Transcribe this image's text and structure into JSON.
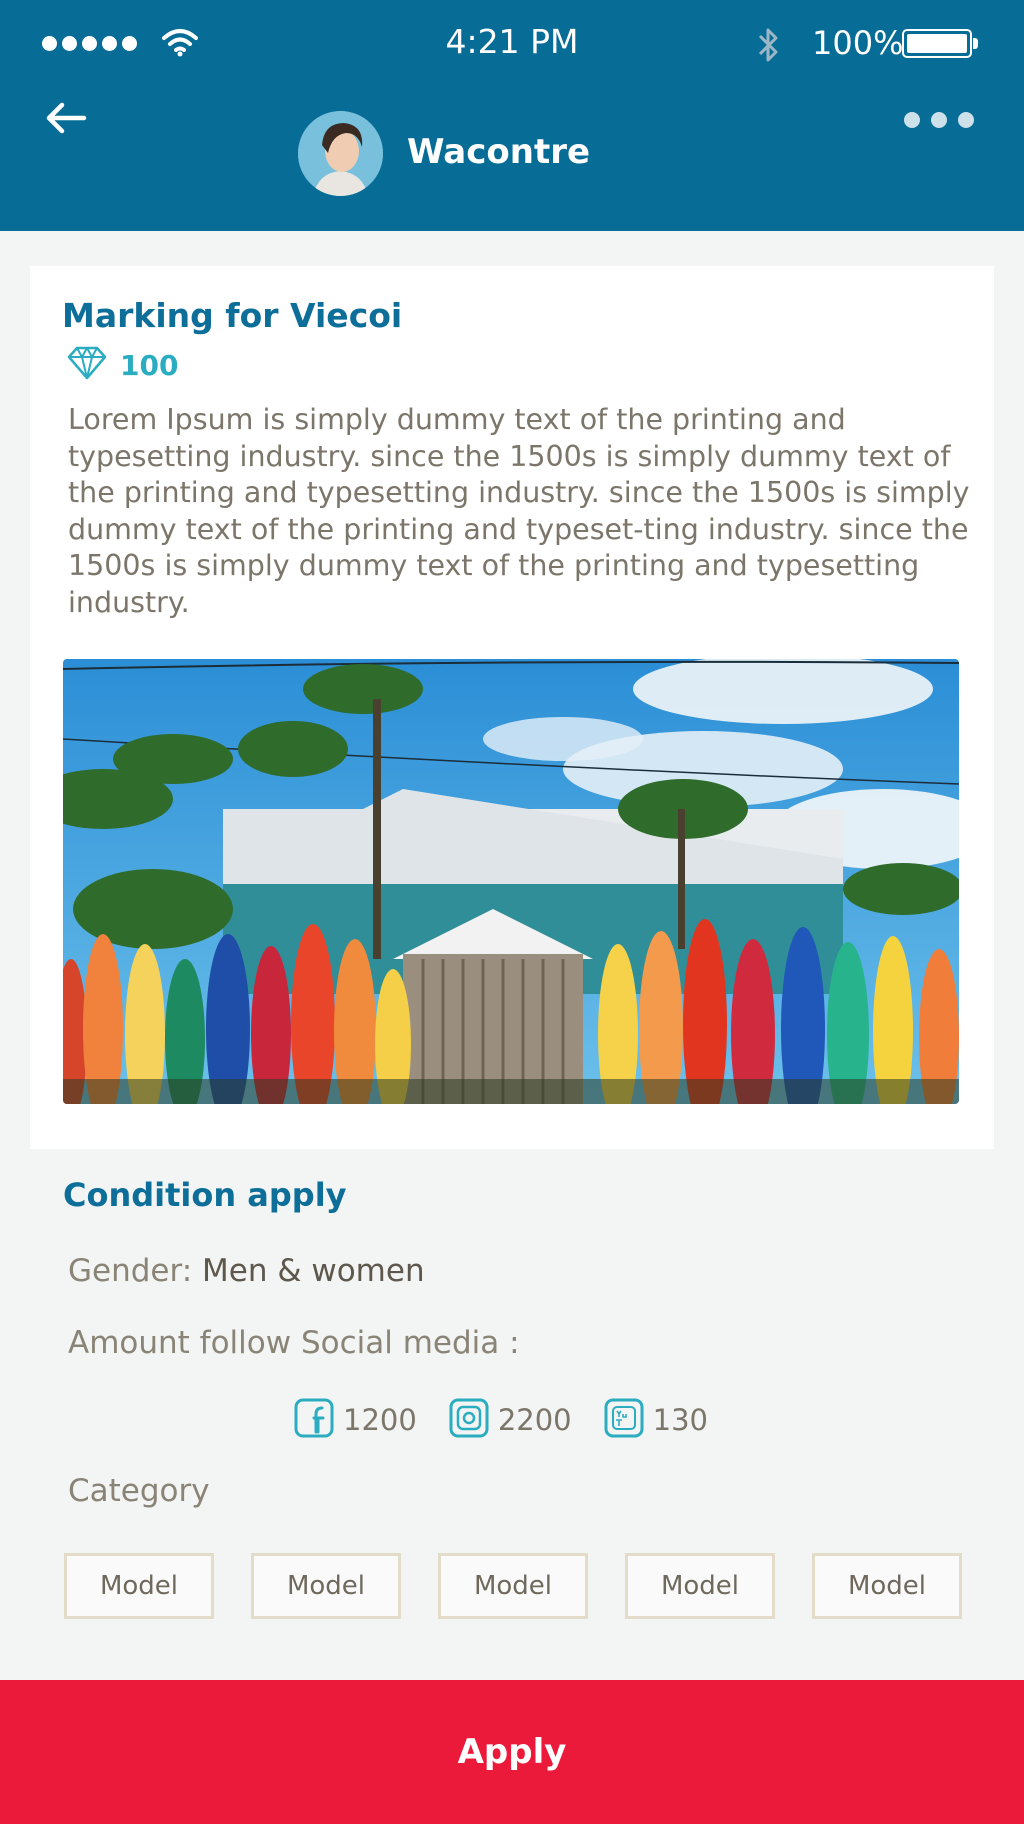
{
  "status_bar": {
    "time": "4:21 PM",
    "battery_percent": "100%"
  },
  "header": {
    "contact_name": "Wacontre",
    "icons": [
      "back-arrow-icon",
      "avatar",
      "more-icon"
    ]
  },
  "campaign": {
    "title": "Marking for Viecoi",
    "points": "100",
    "points_icon": "diamond-icon",
    "description": "Lorem Ipsum is simply dummy text of the printing and typesetting industry. since the 1500s is simply dummy text of the printing and typesetting industry. since the 1500s is simply dummy text of the printing and typeset-ting industry. since the 1500s is simply dummy text of the printing and typesetting industry."
  },
  "conditions": {
    "title": "Condition apply",
    "gender_label": "Gender:",
    "gender_value": "Men & women",
    "amount_label": "Amount follow Social media :",
    "socials": [
      {
        "icon": "facebook-icon",
        "count": "1200"
      },
      {
        "icon": "instagram-icon",
        "count": "2200"
      },
      {
        "icon": "youtube-icon",
        "count": "130"
      }
    ],
    "category_label": "Category",
    "categories": [
      "Model",
      "Model",
      "Model",
      "Model",
      "Model"
    ]
  },
  "actions": {
    "apply_label": "Apply"
  },
  "colors": {
    "header_bg": "#076c96",
    "accent_blue": "#0d6e99",
    "accent_teal": "#2badc1",
    "apply_red": "#ec1a3a"
  }
}
